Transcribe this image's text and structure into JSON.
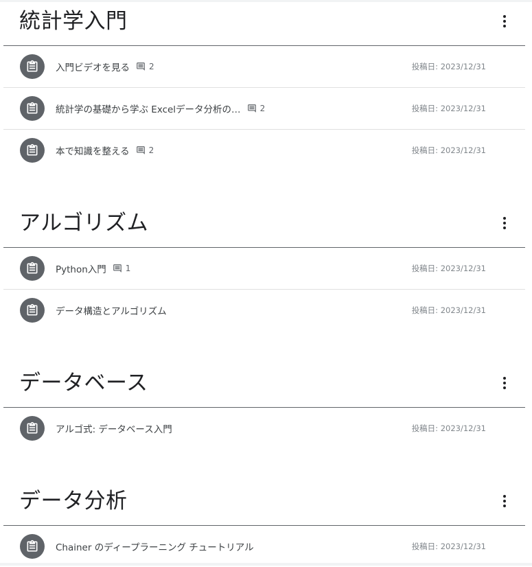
{
  "topics": [
    {
      "title": "統計学入門",
      "items": [
        {
          "title": "入門ビデオを見る",
          "comments": "2",
          "date": "投稿日: 2023/12/31"
        },
        {
          "title": "統計学の基礎から学ぶ Excelデータ分析の…",
          "comments": "2",
          "date": "投稿日: 2023/12/31"
        },
        {
          "title": "本で知識を整える",
          "comments": "2",
          "date": "投稿日: 2023/12/31"
        }
      ]
    },
    {
      "title": "アルゴリズム",
      "items": [
        {
          "title": "Python入門",
          "comments": "1",
          "date": "投稿日: 2023/12/31"
        },
        {
          "title": "データ構造とアルゴリズム",
          "comments": null,
          "date": "投稿日: 2023/12/31"
        }
      ]
    },
    {
      "title": "データベース",
      "items": [
        {
          "title": "アルゴ式: データベース入門",
          "comments": null,
          "date": "投稿日: 2023/12/31"
        }
      ]
    },
    {
      "title": "データ分析",
      "items": [
        {
          "title": "Chainer のディープラーニング チュートリアル",
          "comments": null,
          "date": "投稿日: 2023/12/31"
        }
      ]
    }
  ],
  "icons": {
    "item": "assignment-icon",
    "comment": "comment-icon",
    "menu": "more-vert-icon"
  },
  "colors": {
    "icon_circle": "#5f6368",
    "divider_strong": "#5f6368",
    "divider_light": "#e0e0e0",
    "date_text": "#80868b"
  }
}
